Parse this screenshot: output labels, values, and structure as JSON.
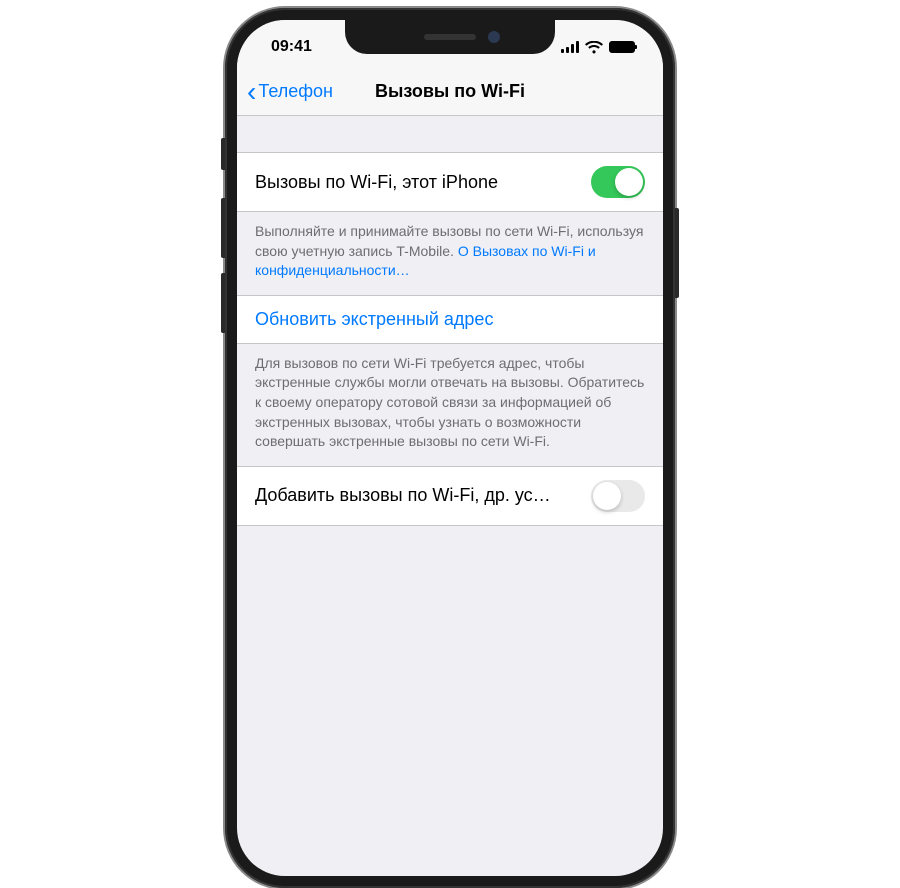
{
  "status": {
    "time": "09:41"
  },
  "nav": {
    "back_label": "Телефон",
    "title": "Вызовы по Wi-Fi"
  },
  "cells": {
    "wifi_calling_this_iphone": "Вызовы по Wi-Fi, этот iPhone",
    "wifi_calling_footer_text": "Выполняйте и принимайте вызовы по сети Wi-Fi, используя свою учетную запись T-Mobile. ",
    "wifi_calling_footer_link": "О Вызовах по Wi-Fi и конфиденциальности…",
    "emergency_address": "Обновить экстренный адрес",
    "emergency_footer": "Для вызовов по сети Wi-Fi требуется адрес, чтобы экстренные службы могли отвечать на вызовы. Обратитесь к своему оператору сотовой связи за информацией об экстренных вызовах, чтобы узнать о возможности совершать экстренные вызовы по сети Wi-Fi.",
    "add_wifi_calling_other": "Добавить вызовы по Wi-Fi, др. ус…"
  },
  "toggles": {
    "this_iphone": true,
    "other_devices": false
  }
}
